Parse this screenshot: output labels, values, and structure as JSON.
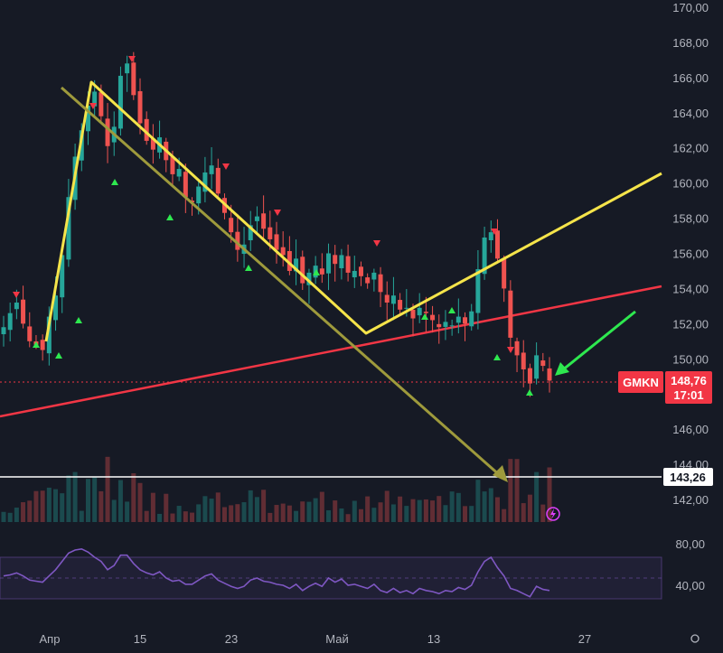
{
  "chart_data": {
    "type": "candlestick",
    "ticker": "GMKN",
    "price_axis": {
      "ticks": [
        "170,00",
        "168,00",
        "166,00",
        "164,00",
        "162,00",
        "160,00",
        "158,00",
        "156,00",
        "154,00",
        "152,00",
        "150,00",
        "148,00",
        "146,00",
        "144,00",
        "142,00"
      ],
      "range": [
        141,
        170.5
      ]
    },
    "rsi_axis": {
      "ticks": [
        "80,00",
        "40,00"
      ],
      "band": [
        30,
        70
      ],
      "mid": 50
    },
    "x_axis": {
      "ticks": [
        "Апр",
        "15",
        "23",
        "Май",
        "13",
        "27"
      ]
    },
    "last_price": {
      "label": "148,76",
      "timer": "17:01",
      "value": 148.76,
      "color": "#f23645"
    },
    "level_line": {
      "label": "143,26",
      "value": 143.26,
      "color": "#ffffff"
    },
    "drawings": {
      "zigzag_color": "#f5e44a",
      "arrow_color": "#9e9a3c",
      "moving_average_color": "#f23645",
      "green_arrow_color": "#2ee84f"
    },
    "price_series_close": [
      151.8,
      152.6,
      153.2,
      152.0,
      151.0,
      150.8,
      150.5,
      152.4,
      153.6,
      155.9,
      159.2,
      161.5,
      163.0,
      164.4,
      165.2,
      163.8,
      162.1,
      163.2,
      166.1,
      166.8,
      165.0,
      163.4,
      162.4,
      161.9,
      162.6,
      161.3,
      160.5,
      160.8,
      159.2,
      158.9,
      159.8,
      160.6,
      161.0,
      159.4,
      158.3,
      157.2,
      156.2,
      156.5,
      157.6,
      158.1,
      157.4,
      156.8,
      156.2,
      155.9,
      155.0,
      155.7,
      154.3,
      154.9,
      155.3,
      154.8,
      156.0,
      155.4,
      155.9,
      154.9,
      155.0,
      154.7,
      154.3,
      154.9,
      153.8,
      153.2,
      153.6,
      152.8,
      152.9,
      152.3,
      152.9,
      152.6,
      152.2,
      151.8,
      152.1,
      151.9,
      152.4,
      152.0,
      152.7,
      155.1,
      156.9,
      157.2,
      155.7,
      154.0,
      151.2,
      150.2,
      149.4,
      148.6,
      150.2,
      149.6,
      148.76
    ],
    "rsi_series": [
      52,
      53,
      55,
      52,
      48,
      47,
      46,
      52,
      58,
      66,
      74,
      77,
      78,
      75,
      70,
      66,
      58,
      62,
      72,
      72,
      64,
      58,
      55,
      53,
      56,
      50,
      47,
      48,
      44,
      44,
      48,
      52,
      54,
      48,
      45,
      42,
      40,
      42,
      48,
      50,
      47,
      46,
      44,
      43,
      40,
      44,
      38,
      42,
      45,
      42,
      50,
      46,
      49,
      43,
      44,
      42,
      40,
      44,
      38,
      36,
      40,
      36,
      38,
      35,
      40,
      38,
      37,
      35,
      38,
      37,
      41,
      39,
      43,
      56,
      66,
      70,
      60,
      52,
      40,
      38,
      35,
      32,
      42,
      39,
      38
    ]
  }
}
